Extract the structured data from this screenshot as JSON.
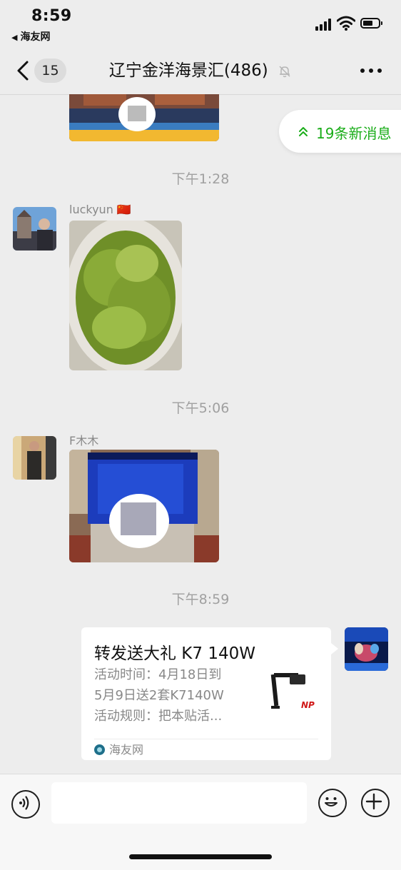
{
  "status_bar": {
    "time": "8:59",
    "back_app_label": "海友网",
    "icons": [
      "cellular-signal-icon",
      "wifi-icon",
      "battery-icon"
    ]
  },
  "nav": {
    "unread_count": "15",
    "title": "辽宁金洋海景汇(486)",
    "icons": [
      "chevron-left-icon",
      "mute-bell-icon",
      "more-dots-icon"
    ]
  },
  "new_messages": {
    "label": "19条新消息",
    "icon": "double-chevron-up-icon",
    "accent_color": "#1aad19"
  },
  "messages": [
    {
      "type": "timestamp",
      "text": "下午1:28"
    },
    {
      "type": "image",
      "sender": "luckyun 🇨🇳",
      "content": "green macroalgae in a white bowl"
    },
    {
      "type": "timestamp",
      "text": "下午5:06"
    },
    {
      "type": "image",
      "sender": "F木木",
      "content": "blue lit aquarium tank with blurred QR code"
    },
    {
      "type": "timestamp",
      "text": "下午8:59"
    },
    {
      "type": "link_card",
      "outgoing": true,
      "title": "转发送大礼 K7 140W",
      "description_lines": [
        "活动时间：4月18日到",
        "5月9日送2套K7140W",
        "活动规则：把本贴活..."
      ],
      "source": "海友网",
      "thumbnail_icon": "aquarium-light-product-icon"
    }
  ],
  "input_bar": {
    "icons": [
      "voice-icon",
      "emoji-icon",
      "plus-icon"
    ]
  }
}
